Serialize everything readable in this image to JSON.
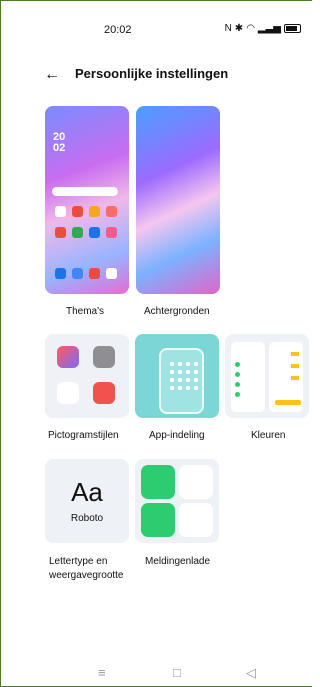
{
  "status": {
    "time": "20:02"
  },
  "header": {
    "title": "Persoonlijke instellingen"
  },
  "preview": {
    "time_top": "20",
    "time_bottom": "02"
  },
  "grid": {
    "themes": "Thema's",
    "wallpapers": "Achtergronden",
    "icon_styles": "Pictogramstijlen",
    "app_layout": "App-indeling",
    "colors": "Kleuren",
    "font_line1": "Lettertype en",
    "font_line2": "weergavegrootte",
    "notification": "Meldingenlade",
    "font_sample": "Aa",
    "font_name": "Roboto"
  },
  "icons": {
    "back": "←",
    "nav_menu": "≡",
    "nav_home": "□",
    "nav_back": "◁"
  }
}
